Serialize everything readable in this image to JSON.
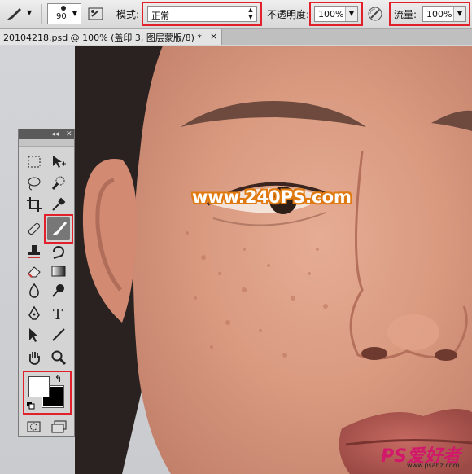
{
  "options_bar": {
    "brush_size": "90",
    "mode_label": "模式:",
    "mode_value": "正常",
    "opacity_label": "不透明度:",
    "opacity_value": "100%",
    "flow_label": "流量:",
    "flow_value": "100%"
  },
  "document_tab": {
    "title": "20104218.psd @ 100% (盖印 3, 图层蒙版/8) *",
    "close": "×"
  },
  "toolbox": {
    "collapse": "◂◂",
    "close": "✕",
    "selected_tool": "brush"
  },
  "watermark": {
    "text": "www.240PS.com"
  },
  "logo": {
    "text": "PS爱好者",
    "url": "www.psahz.com"
  },
  "colors": {
    "highlight": "#e0202a",
    "foreground": "#ffffff",
    "background": "#000000",
    "watermark_outline": "#e07a10"
  }
}
